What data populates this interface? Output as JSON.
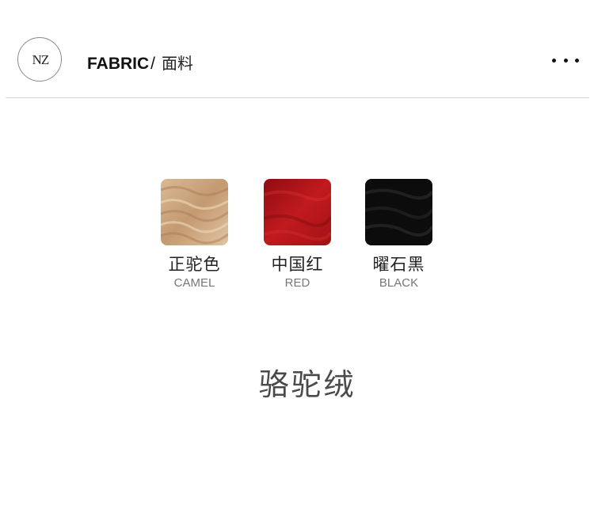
{
  "header": {
    "logo_text": "NZ",
    "title_en": "FABRIC",
    "title_sep": "/",
    "title_cn": "面料",
    "more_icon": "more-horizontal-icon"
  },
  "swatches": [
    {
      "name_cn": "正驼色",
      "name_en": "CAMEL",
      "color": "#c9a27a"
    },
    {
      "name_cn": "中国红",
      "name_en": "RED",
      "color": "#b2161b"
    },
    {
      "name_cn": "曜石黑",
      "name_en": "BLACK",
      "color": "#0e0e0e"
    }
  ],
  "material_name": "骆驼绒"
}
